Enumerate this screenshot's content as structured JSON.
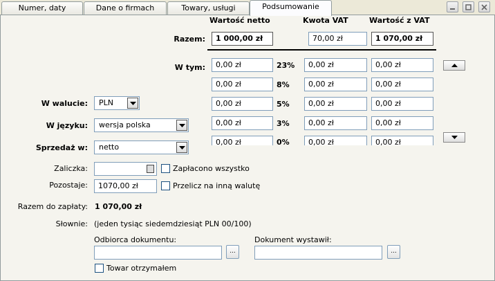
{
  "tabs": [
    {
      "label": "Numer, daty"
    },
    {
      "label": "Dane o firmach"
    },
    {
      "label": "Towary, usługi"
    },
    {
      "label": "Podsumowanie"
    }
  ],
  "headers": {
    "netto": "Wartość netto",
    "vat": "Kwota VAT",
    "brutto": "Wartość z VAT"
  },
  "razem": {
    "label": "Razem:",
    "netto": "1 000,00 zł",
    "vat": "70,00 zł",
    "brutto": "1 070,00 zł"
  },
  "w_tym_label": "W tym:",
  "rates": [
    {
      "pct": "23%",
      "netto": "0,00 zł",
      "vat": "0,00 zł",
      "brutto": "0,00 zł"
    },
    {
      "pct": "8%",
      "netto": "0,00 zł",
      "vat": "0,00 zł",
      "brutto": "0,00 zł"
    },
    {
      "pct": "5%",
      "netto": "0,00 zł",
      "vat": "0,00 zł",
      "brutto": "0,00 zł"
    },
    {
      "pct": "3%",
      "netto": "0,00 zł",
      "vat": "0,00 zł",
      "brutto": "0,00 zł"
    },
    {
      "pct": "0%",
      "netto": "0,00 zł",
      "vat": "0,00 zł",
      "brutto": "0,00 zł"
    }
  ],
  "waluta": {
    "label": "W walucie:",
    "value": "PLN"
  },
  "jezyk": {
    "label": "W języku:",
    "value": "wersja polska"
  },
  "sprzedaz": {
    "label": "Sprzedaż w:",
    "value": "netto"
  },
  "zaliczka": {
    "label": "Zaliczka:",
    "value": ""
  },
  "zaplacono": {
    "label": "Zapłacono wszystko"
  },
  "pozostaje": {
    "label": "Pozostaje:",
    "value": "1070,00 zł"
  },
  "przelicz": {
    "label": "Przelicz na inną walutę"
  },
  "razem_do_zaplaty": {
    "label": "Razem do zapłaty:",
    "value": "1 070,00 zł"
  },
  "slownie": {
    "label": "Słownie:",
    "value": "(jeden tysiąc siedemdziesiąt PLN 00/100)"
  },
  "odbiorca": {
    "label": "Odbiorca dokumentu:",
    "value": ""
  },
  "wystawil": {
    "label": "Dokument wystawił:",
    "value": ""
  },
  "towar": {
    "label": "Towar otrzymałem"
  },
  "browse_label": "...",
  "icons": {
    "minimize": "minimize-icon",
    "maximize": "maximize-icon",
    "close": "close-icon",
    "up": "arrow-up-icon",
    "down": "arrow-down-icon",
    "calendar": "calendar-icon"
  }
}
